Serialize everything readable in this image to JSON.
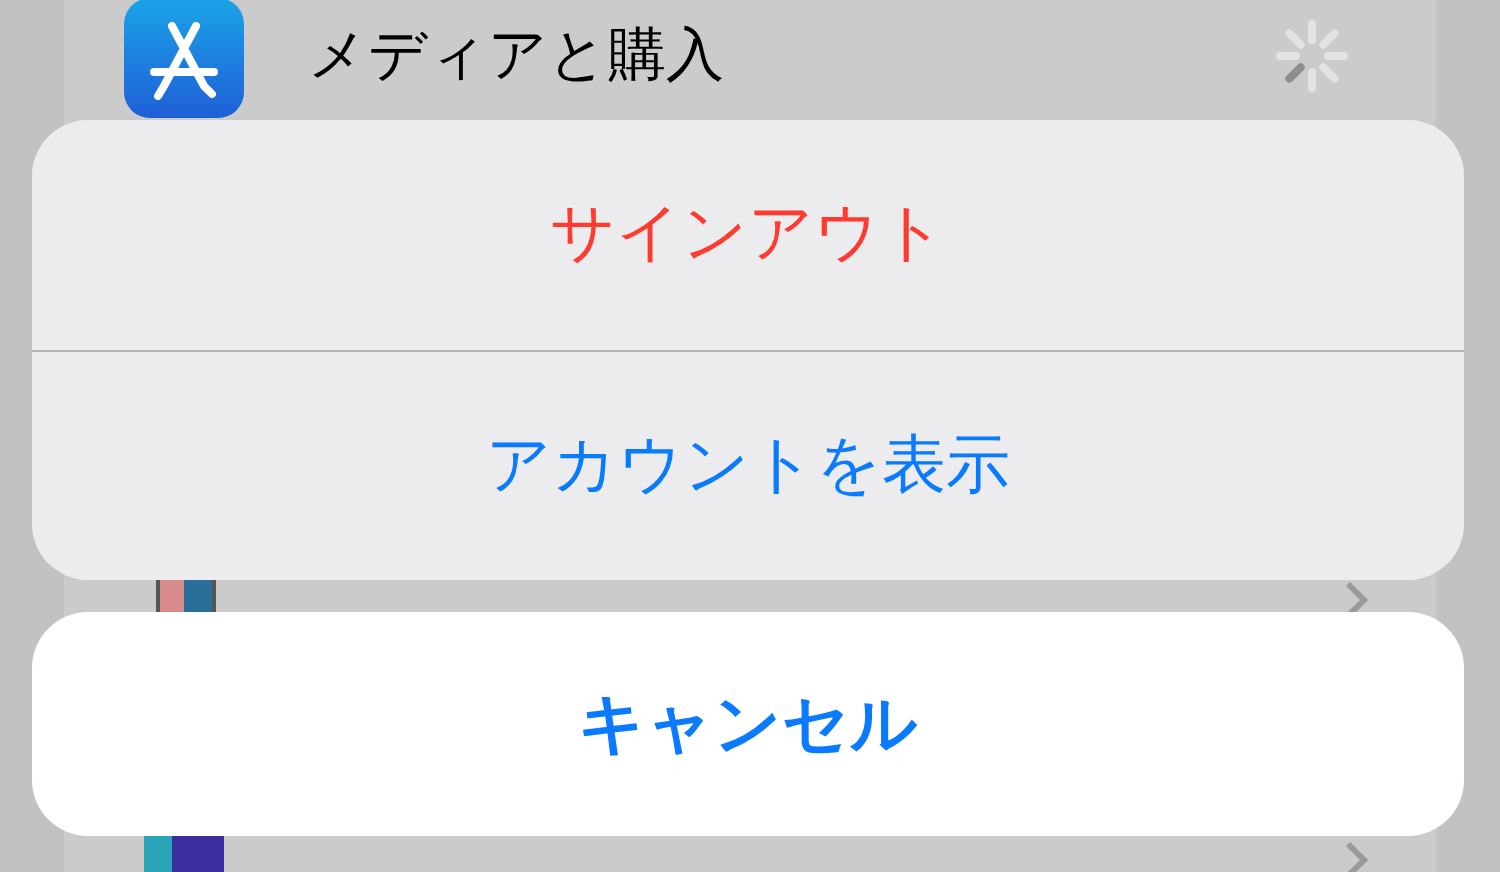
{
  "background_list": {
    "rows": [
      {
        "title": "メディアと購入",
        "loading": true
      }
    ]
  },
  "action_sheet": {
    "actions": [
      {
        "label": "サインアウト",
        "kind": "destructive"
      },
      {
        "label": "アカウントを表示",
        "kind": "default"
      }
    ],
    "cancel": {
      "label": "キャンセル"
    }
  }
}
